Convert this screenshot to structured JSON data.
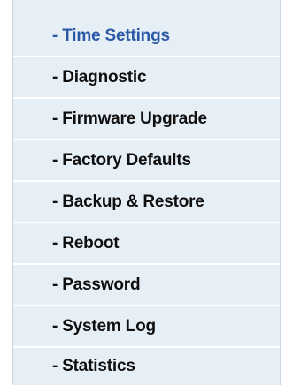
{
  "menu": {
    "items": [
      {
        "label": "- Time Settings",
        "active": true
      },
      {
        "label": "- Diagnostic",
        "active": false
      },
      {
        "label": "- Firmware Upgrade",
        "active": false
      },
      {
        "label": "- Factory Defaults",
        "active": false
      },
      {
        "label": "- Backup & Restore",
        "active": false
      },
      {
        "label": "- Reboot",
        "active": false
      },
      {
        "label": "- Password",
        "active": false
      },
      {
        "label": "- System Log",
        "active": false
      },
      {
        "label": "- Statistics",
        "active": false
      }
    ],
    "colors": {
      "background": "#e6eef6",
      "active_text": "#2a5aa6",
      "text": "#0f0f0f",
      "separator": "#ffffff"
    }
  }
}
